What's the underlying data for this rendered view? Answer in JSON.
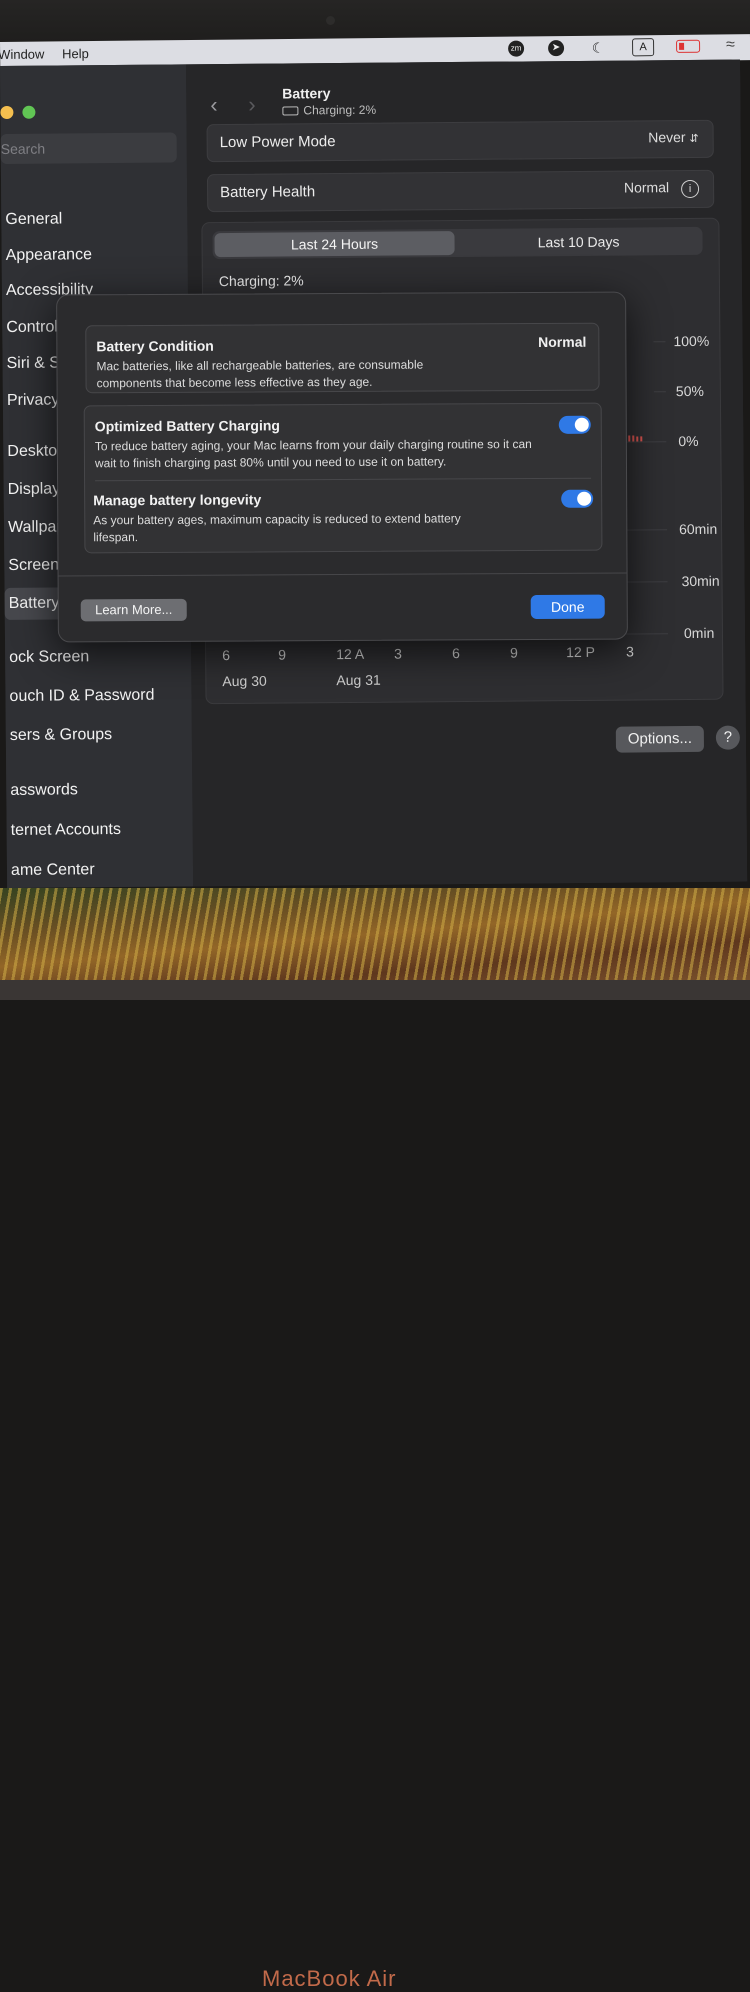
{
  "menubar": {
    "items": [
      "Window",
      "Help"
    ],
    "status_icons": [
      "zoom-icon",
      "location-arrow-icon",
      "moon-icon",
      "input-source-icon",
      "battery-charging-icon",
      "wifi-icon"
    ],
    "input_source": "A",
    "zoom_badge": "zm"
  },
  "sidebar": {
    "search_placeholder": "Search",
    "items": [
      {
        "label": "General"
      },
      {
        "label": "Appearance"
      },
      {
        "label": "Accessibility"
      },
      {
        "label": "Control C"
      },
      {
        "label": "Siri & Sp"
      },
      {
        "label": "Privacy &"
      },
      {
        "label": "Desktop"
      },
      {
        "label": "Displays"
      },
      {
        "label": "Wallpape"
      },
      {
        "label": "Screen S"
      },
      {
        "label": "Battery",
        "selected": true
      },
      {
        "label": "ock Screen"
      },
      {
        "label": "ouch ID & Password"
      },
      {
        "label": "sers & Groups"
      },
      {
        "label": "asswords"
      },
      {
        "label": "ternet Accounts"
      },
      {
        "label": "ame Center"
      }
    ]
  },
  "header": {
    "title": "Battery",
    "subtitle": "Charging: 2%"
  },
  "settings": {
    "low_power_label": "Low Power Mode",
    "low_power_value": "Never",
    "health_label": "Battery Health",
    "health_value": "Normal"
  },
  "graph": {
    "tab_24h": "Last 24 Hours",
    "tab_10d": "Last 10 Days",
    "active_tab": "Last 24 Hours",
    "charging_text": "Charging: 2%",
    "level_axis": [
      "100%",
      "50%",
      "0%"
    ],
    "usage_axis": [
      "60min",
      "30min",
      "0min"
    ],
    "time_ticks": [
      "6",
      "9",
      "12 A",
      "3",
      "6",
      "9",
      "12 P",
      "3"
    ],
    "date_labels": [
      "Aug 30",
      "Aug 31"
    ]
  },
  "footer": {
    "options_label": "Options...",
    "help_label": "?"
  },
  "modal": {
    "condition_title": "Battery Condition",
    "condition_value": "Normal",
    "condition_desc": "Mac batteries, like all rechargeable batteries, are consumable components that become less effective as they age.",
    "optimized_title": "Optimized Battery Charging",
    "optimized_desc": "To reduce battery aging, your Mac learns from your daily charging routine so it can wait to finish charging past 80% until you need to use it on battery.",
    "optimized_on": true,
    "longevity_title": "Manage battery longevity",
    "longevity_desc": "As your battery ages, maximum capacity is reduced to extend battery lifespan.",
    "longevity_on": true,
    "learn_more_label": "Learn More...",
    "done_label": "Done"
  },
  "colors": {
    "accent": "#2f79e6",
    "battery_low": "#d9534f"
  },
  "device": {
    "label": "MacBook Air"
  }
}
